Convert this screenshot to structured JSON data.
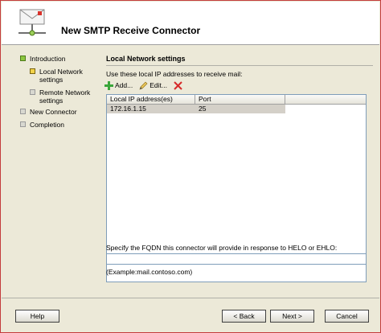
{
  "window": {
    "title": "New SMTP Receive Connector"
  },
  "nav": {
    "items": [
      {
        "label": "Introduction",
        "state": "complete"
      },
      {
        "label": "Local Network settings",
        "state": "current"
      },
      {
        "label": "Remote Network settings",
        "state": "pending"
      },
      {
        "label": "New Connector",
        "state": "pending"
      },
      {
        "label": "Completion",
        "state": "pending"
      }
    ]
  },
  "section": {
    "title": "Local Network settings",
    "instruction": "Use these local IP addresses to receive mail:"
  },
  "toolbar": {
    "add_label": "Add...",
    "edit_label": "Edit...",
    "delete_icon": "delete-x-icon"
  },
  "table": {
    "columns": [
      "Local IP address(es)",
      "Port"
    ],
    "rows": [
      {
        "ip": "172.16.1.15",
        "port": "25"
      }
    ]
  },
  "fqdn": {
    "label": "Specify the FQDN this connector will provide in response to HELO or EHLO:",
    "value": "",
    "example": "(Example:mail.contoso.com)"
  },
  "buttons": {
    "help": "Help",
    "back": "< Back",
    "next": "Next >",
    "cancel": "Cancel"
  },
  "colors": {
    "complete": "#8cc63f",
    "current": "#f2d34a",
    "pending": "#d8d8d0",
    "selected_row": "#d4d0c8"
  }
}
